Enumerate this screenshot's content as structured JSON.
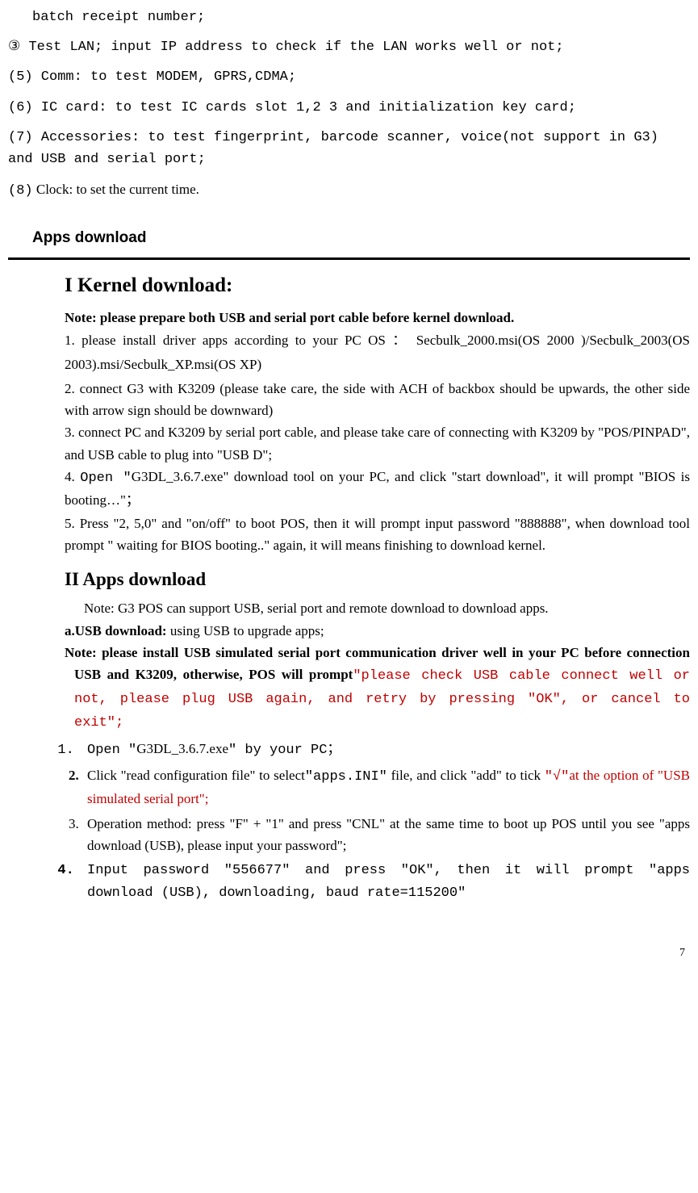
{
  "top": {
    "line1": "batch receipt number;",
    "line2": "③ Test LAN; input IP address to check if the LAN works well or not;",
    "item5": "(5) Comm: to test MODEM, GPRS,CDMA;",
    "item6": "(6) IC card: to test IC cards slot 1,2 3 and initialization key card;",
    "item7": "(7) Accessories: to test fingerprint, barcode scanner, voice(not support in G3) and USB and serial port;",
    "item8_prefix": "(8)",
    "item8_body": "  Clock: to set the current time."
  },
  "section_header": "Apps download",
  "kernel": {
    "title": "I Kernel download:",
    "note": "Note: please prepare both USB and serial port cable before kernel download.",
    "p1": "1. please install driver apps according to your PC OS ： Secbulk_2000.msi(OS 2000 )/Secbulk_2003(OS 2003).msi/Secbulk_XP.msi(OS XP)",
    "p2": "2. connect G3 with K3209 (please take care, the side with ACH of backbox should be upwards, the other side with arrow sign should be downward)",
    "p3": "3. connect PC and K3209 by serial port cable, and please take care of connecting with K3209 by \"POS/PINPAD\", and USB cable to plug into \"USB D\";",
    "p4_a": "4. ",
    "p4_open": "Open ",
    "p4_quote": "\"",
    "p4_b": "G3DL_3.6.7.exe\" download tool on your PC, and click \"start download\", it will prompt \"BIOS is booting…\"",
    "p4_semi": "；",
    "p5": "5. Press \"2, 5,0\"  and \"on/off\" to boot POS, then it will prompt input password \"888888\", when download tool prompt \" waiting for BIOS booting..\" again, it will means finishing to download kernel."
  },
  "apps": {
    "title": "II Apps download",
    "note_indent": "Note: G3 POS can support USB, serial port and remote download to download apps.",
    "a_bold": "a.USB download: ",
    "a_rest": "using USB to upgrade apps;",
    "note2_bold": "Note: please install USB simulated serial port communication driver well in your PC before connection USB and K3209, otherwise, POS will prompt",
    "note2_red": "\"please check USB cable connect well or not, please plug USB again, and retry by pressing \"OK\", or cancel to exit\";",
    "steps": {
      "s1_a": "Open ",
      "s1_b": "\"",
      "s1_c": "G3DL_3.6.7.exe",
      "s1_d": "\" by your PC；",
      "s2_a": "Click \"read configuration file\" to select",
      "s2_b": "\"apps.INI\"",
      "s2_c": " file, and click \"add\" to tick",
      "s2_d": "\"√\"",
      "s2_e": "at the option of \"USB simulated serial port\";",
      "s3": "Operation method: press \"F\" + \"1\" and press \"CNL\" at the same time to boot up POS until you see \"apps download (USB), please input your password\";",
      "s4": "Input password \"556677\" and press \"OK\", then it will prompt \"apps download (USB), downloading, baud rate=115200\""
    }
  },
  "page_number": "7"
}
